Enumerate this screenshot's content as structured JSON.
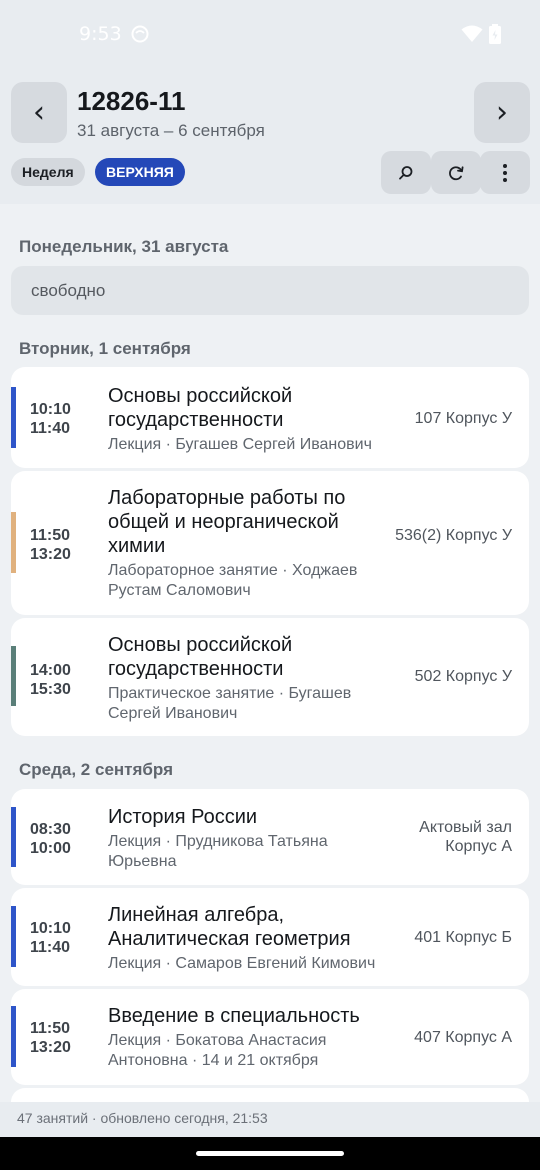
{
  "status_bar": {
    "time": "9:53"
  },
  "header": {
    "group": "12826-11",
    "date_range": "31 августа – 6 сентября",
    "prev_glyph": "‹",
    "next_glyph": "›",
    "week_chip": "Неделя",
    "parity_chip": "ВЕРХНЯЯ",
    "parity_color": "#2448b8"
  },
  "days": [
    {
      "title": "Понедельник, 31 августа",
      "free_text": "свободно",
      "lessons": []
    },
    {
      "title": "Вторник, 1 сентября",
      "lessons": [
        {
          "start": "10:10",
          "end": "11:40",
          "subject": "Основы российской государственности",
          "meta": "Лекция · Бугашев Сергей Иванович",
          "room": "107 Корпус У",
          "accent": "#2e55c9"
        },
        {
          "start": "11:50",
          "end": "13:20",
          "subject": "Лабораторные работы по общей и неорганической химии",
          "meta": "Лабораторное занятие · Ходжаев Рустам Саломович",
          "room": "536(2) Корпус У",
          "accent": "#e0b17e"
        },
        {
          "start": "14:00",
          "end": "15:30",
          "subject": "Основы российской государственности",
          "meta": "Практическое занятие · Бугашев Сергей Иванович",
          "room": "502 Корпус У",
          "accent": "#5a7f79"
        }
      ]
    },
    {
      "title": "Среда, 2 сентября",
      "lessons": [
        {
          "start": "08:30",
          "end": "10:00",
          "subject": "История России",
          "meta": "Лекция · Прудникова Татьяна Юрьевна",
          "room": "Актовый зал Корпус А",
          "accent": "#2e55c9"
        },
        {
          "start": "10:10",
          "end": "11:40",
          "subject": "Линейная алгебра, Аналитическая геометрия",
          "meta": "Лекция · Самаров Евгений Кимович",
          "room": "401 Корпус Б",
          "accent": "#2e55c9"
        },
        {
          "start": "11:50",
          "end": "13:20",
          "subject": "Введение в специальность",
          "meta": "Лекция · Бокатова Анастасия Антоновна · 14 и 21 октября",
          "room": "407 Корпус А",
          "accent": "#2e55c9"
        }
      ]
    }
  ],
  "footer": {
    "text": "47 занятий · обновлено сегодня, 21:53"
  }
}
